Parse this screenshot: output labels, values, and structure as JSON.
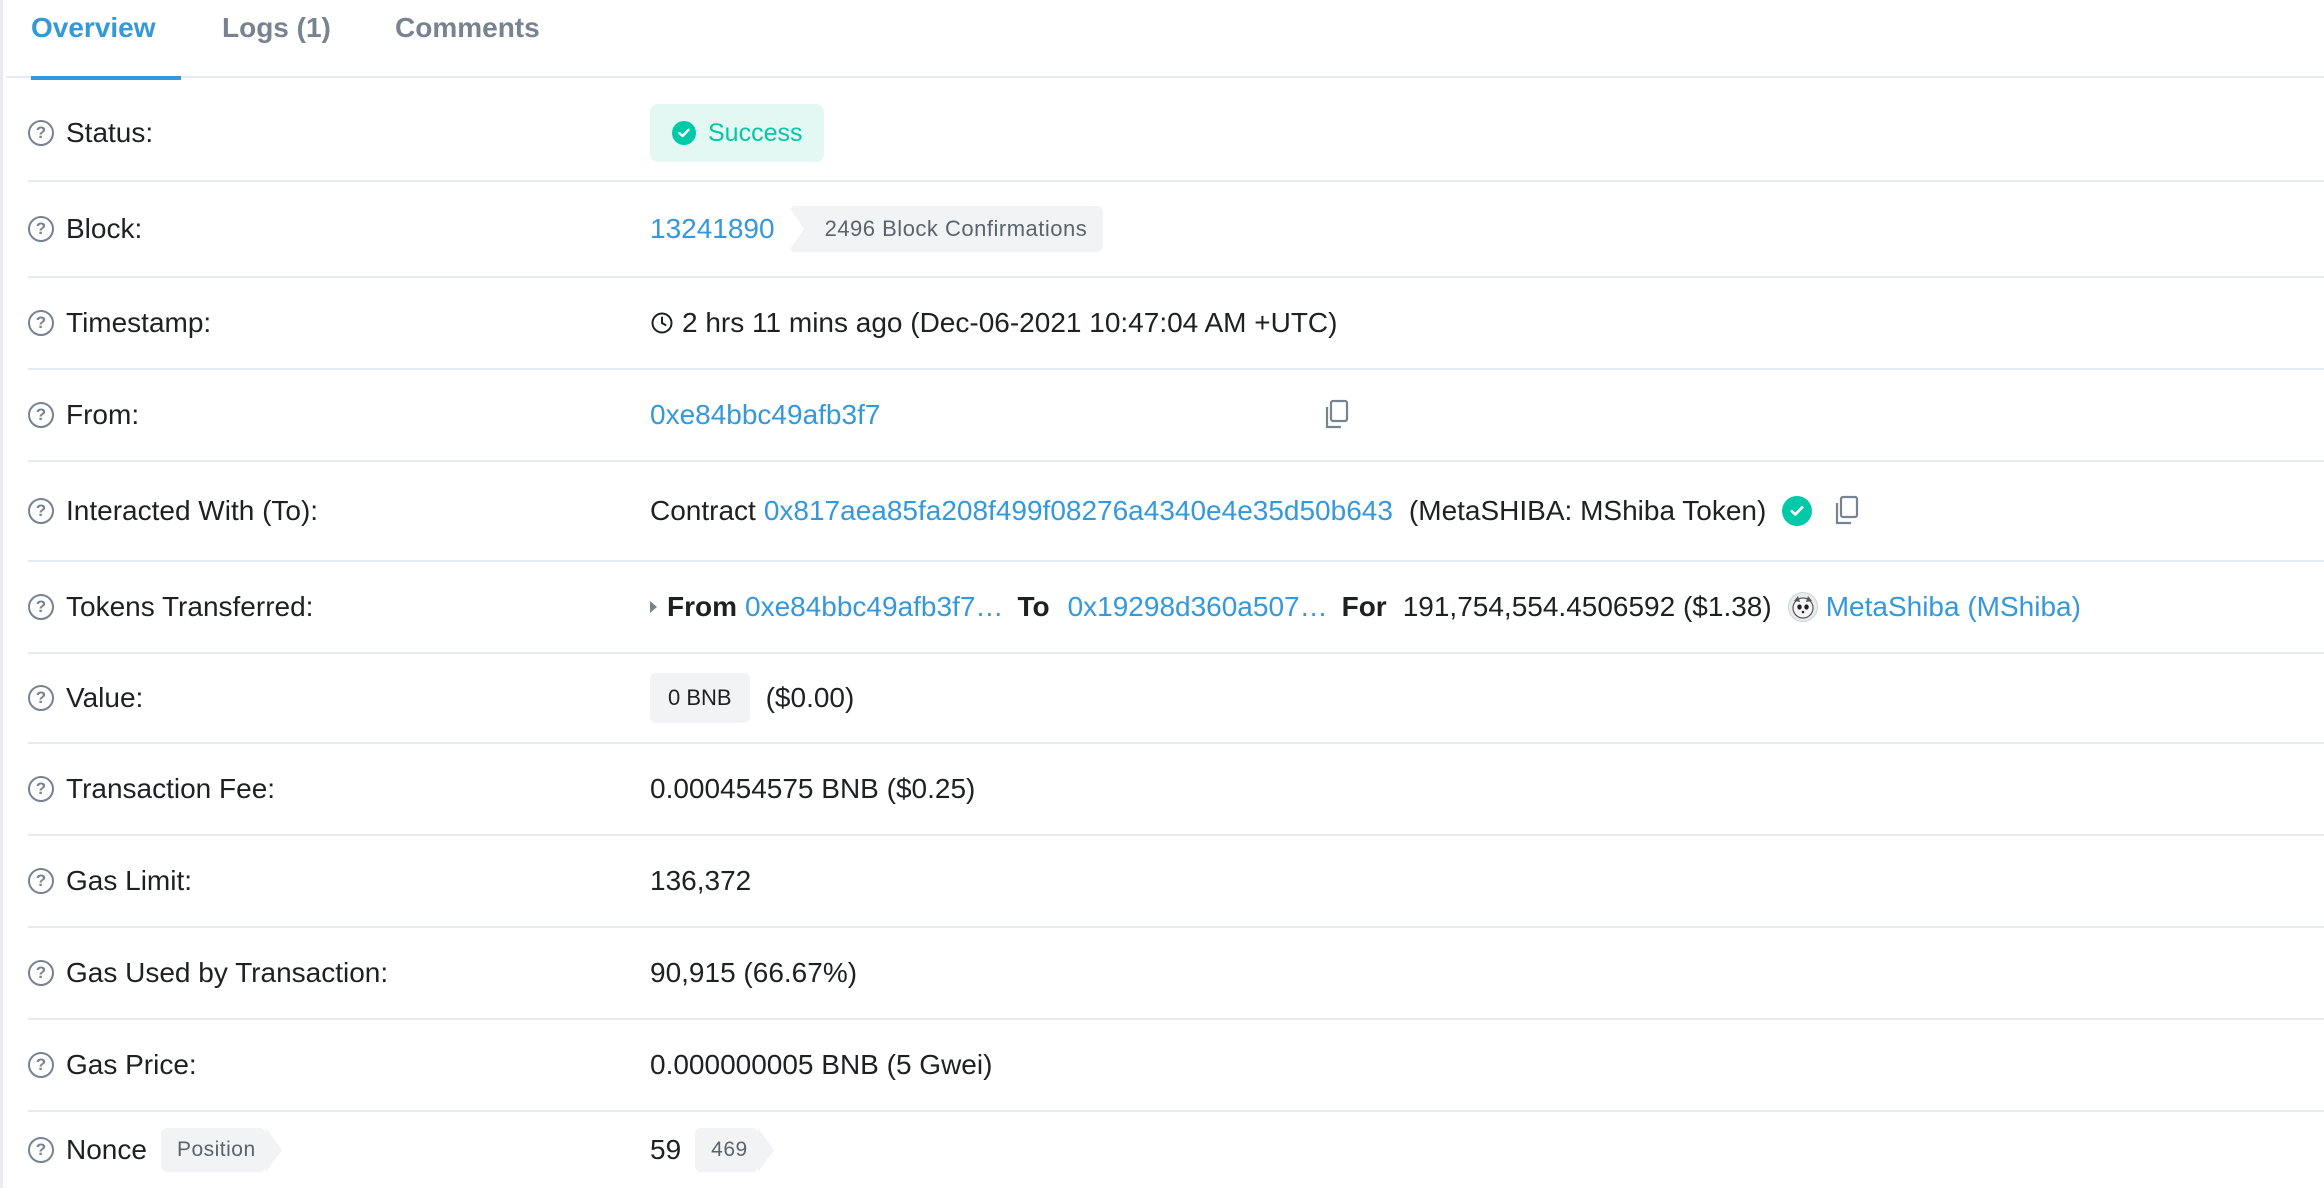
{
  "tabs": [
    {
      "label": "Overview",
      "active": true
    },
    {
      "label": "Logs (1)",
      "active": false
    },
    {
      "label": "Comments",
      "active": false
    }
  ],
  "rows": {
    "status": {
      "label": "Status:",
      "value": "Success"
    },
    "block": {
      "label": "Block:",
      "number": "13241890",
      "confirmations": "2496 Block Confirmations"
    },
    "timestamp": {
      "label": "Timestamp:",
      "value": "2 hrs 11 mins ago (Dec-06-2021 10:47:04 AM +UTC)"
    },
    "from": {
      "label": "From:",
      "address": "0xe84bbc49afb3f7"
    },
    "interacted": {
      "label": "Interacted With (To):",
      "prefix": "Contract",
      "address": "0x817aea85fa208f499f08276a4340e4e35d50b643",
      "name": "(MetaSHIBA: MShiba Token)"
    },
    "tokens": {
      "label": "Tokens Transferred:",
      "from_label": "From",
      "from_address": "0xe84bbc49afb3f7…",
      "to_label": "To",
      "to_address": "0x19298d360a507…",
      "for_label": "For",
      "amount": "191,754,554.4506592 ($1.38)",
      "token_name": "MetaShiba (MShiba)"
    },
    "value": {
      "label": "Value:",
      "amount": "0 BNB",
      "usd": "($0.00)"
    },
    "fee": {
      "label": "Transaction Fee:",
      "value": "0.000454575 BNB ($0.25)"
    },
    "gas_limit": {
      "label": "Gas Limit:",
      "value": "136,372"
    },
    "gas_used": {
      "label": "Gas Used by Transaction:",
      "value": "90,915 (66.67%)"
    },
    "gas_price": {
      "label": "Gas Price:",
      "value": "0.000000005 BNB (5 Gwei)"
    },
    "nonce": {
      "label": "Nonce",
      "position_label": "Position",
      "value": "59",
      "position": "469"
    }
  },
  "colors": {
    "link": "#3498db",
    "success": "#00c9a7",
    "border": "#e7eaf3"
  }
}
